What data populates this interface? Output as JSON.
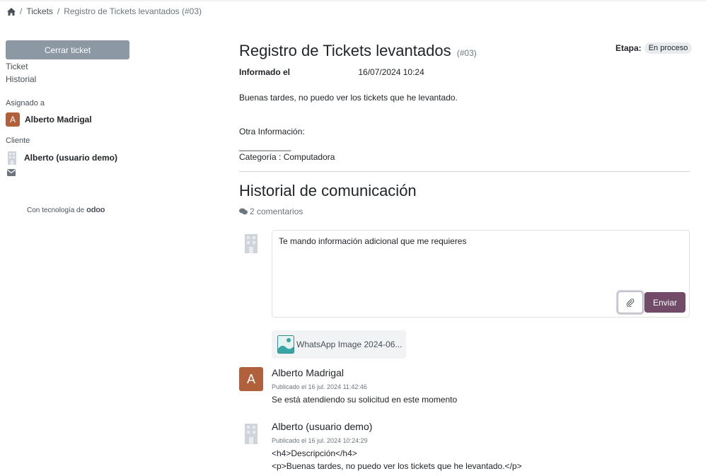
{
  "breadcrumb": {
    "home_icon": "home-icon",
    "items": [
      "Tickets",
      "Registro de Tickets levantados (#03)"
    ],
    "separator": "/"
  },
  "sidebar": {
    "close_button": "Cerrar ticket",
    "links": [
      "Ticket",
      "Historial"
    ],
    "assigned_label": "Asignado a",
    "assignee": {
      "initial": "A",
      "name": "Alberto Madrigal",
      "color": "#b0603a"
    },
    "client_label": "Cliente",
    "client": {
      "name": "Alberto (usuario demo)"
    },
    "powered_by": "Con tecnología de",
    "brand": "odoo"
  },
  "ticket": {
    "title": "Registro de Tickets levantados",
    "ref": "(#03)",
    "stage_label": "Etapa:",
    "stage": "En proceso",
    "reported_label": "Informado el",
    "reported_date": "16/07/2024 10:24",
    "description": "Buenas tardes, no puedo ver los tickets que he levantado.",
    "other_info": "Otra Información:",
    "underline": "___________",
    "category": "Categoría : Computadora"
  },
  "history": {
    "title": "Historial de comunicación",
    "count": "2 comentarios",
    "composer_text": "Te mando información adicional que me requieres",
    "send_button": "Enviar",
    "attachment_name": "WhatsApp Image 2024-06...",
    "messages": [
      {
        "author": "Alberto Madrigal",
        "initial": "A",
        "date": "Publicado el 16 jul. 2024 11:42:46",
        "body": [
          "Se está atendiendo su solicitud en este momento"
        ]
      },
      {
        "author": "Alberto (usuario demo)",
        "date": "Publicado el 16 jul. 2024 10:24:29",
        "body": [
          "<h4>Descripción</h4>",
          "<p>Buenas tardes, no puedo ver los tickets que he levantado.</p>"
        ]
      }
    ]
  },
  "colors": {
    "primary": "#714b67",
    "secondary_button": "#8c98a4",
    "avatar": "#b0603a"
  }
}
